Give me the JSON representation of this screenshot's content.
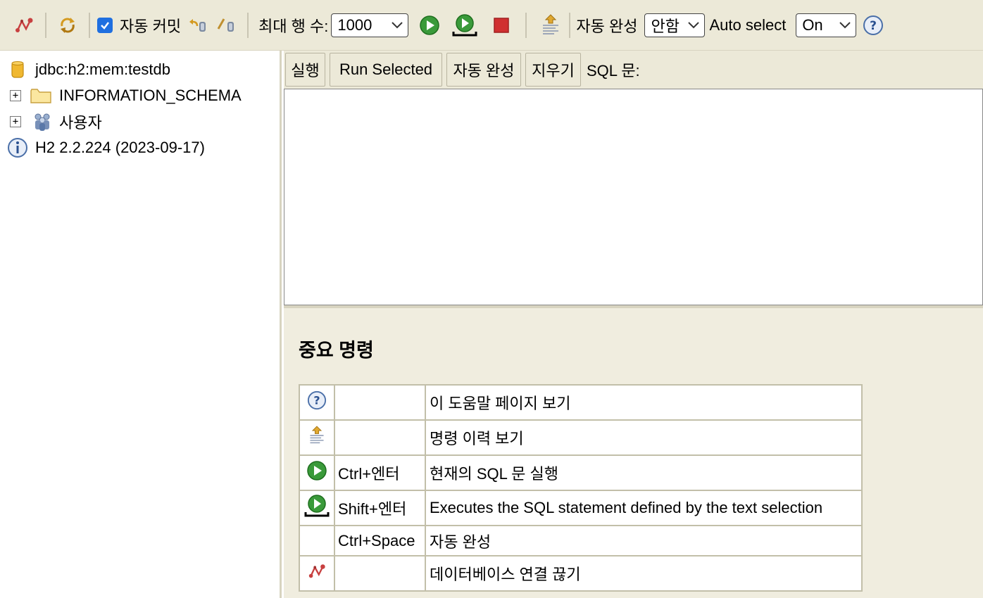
{
  "toolbar": {
    "autocommit_label": "자동 커밋",
    "autocommit_checked": true,
    "max_rows_label": "최대 행 수:",
    "max_rows_value": "1000",
    "autocomplete_label": "자동 완성",
    "autocomplete_value": "안함",
    "autoselect_label": "Auto select",
    "autoselect_value": "On",
    "icons": [
      "disconnect-icon",
      "refresh-icon",
      "rollback-icon",
      "commit-icon",
      "run-icon",
      "run-selected-icon",
      "stop-icon",
      "history-icon",
      "help-icon"
    ]
  },
  "tree": {
    "connection": "jdbc:h2:mem:testdb",
    "schema": "INFORMATION_SCHEMA",
    "users": "사용자",
    "version": "H2 2.2.224 (2023-09-17)",
    "expander_symbol": "+"
  },
  "commands": {
    "run": "실행",
    "run_selected": "Run Selected",
    "autocomplete": "자동 완성",
    "clear": "지우기",
    "sql_label": "SQL 문:"
  },
  "sql_text": "",
  "help": {
    "title": "중요 명령",
    "rows": [
      {
        "icon": "help-icon",
        "key": "",
        "desc": "이 도움말 페이지 보기"
      },
      {
        "icon": "history-icon",
        "key": "",
        "desc": "명령 이력 보기"
      },
      {
        "icon": "run-icon",
        "key": "Ctrl+엔터",
        "desc": "현재의 SQL 문 실행"
      },
      {
        "icon": "run-selected-icon",
        "key": "Shift+엔터",
        "desc": "Executes the SQL statement defined by the text selection"
      },
      {
        "icon": "",
        "key": "Ctrl+Space",
        "desc": "자동 완성"
      },
      {
        "icon": "disconnect-icon",
        "key": "",
        "desc": "데이터베이스 연결 끊기"
      }
    ]
  },
  "colors": {
    "toolbar_bg": "#ece9d8",
    "result_bg": "#f0eddf",
    "run_green": "#3a9a3a",
    "stop_red": "#d03030",
    "checkbox_blue": "#1f6fe0"
  }
}
